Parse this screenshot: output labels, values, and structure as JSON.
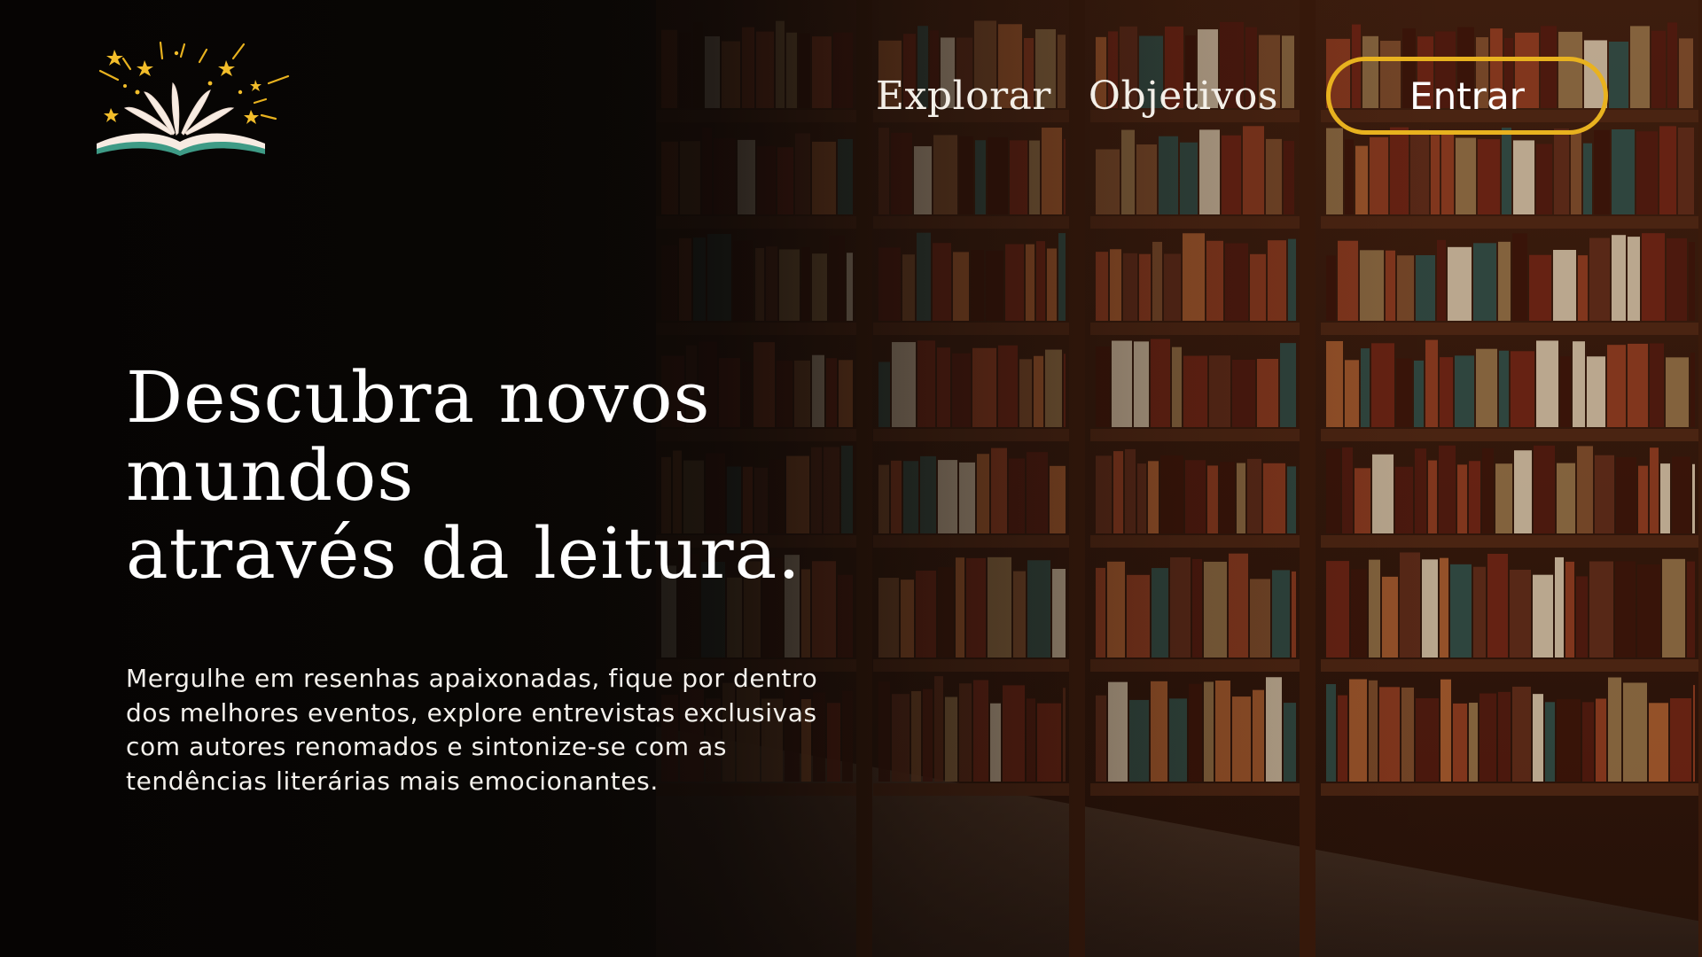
{
  "header": {
    "nav": {
      "explore_label": "Explorar",
      "goals_label": "Objetivos",
      "login_label": "Entrar"
    }
  },
  "hero": {
    "title_lines": [
      "Descubra novos mundos",
      "através da leitura."
    ],
    "description_lines": [
      "Mergulhe em resenhas apaixonadas, fique por dentro",
      "dos melhores eventos, explore entrevistas exclusivas",
      "com autores renomados e sintonize-se com as",
      "tendências literárias mais emocionantes."
    ]
  },
  "colors": {
    "accent": "#e8b21f",
    "text": "#ffffff",
    "background": "#0b0807",
    "wood": "#4a2412"
  },
  "icons": {
    "logo": "open-book-stars-icon"
  }
}
